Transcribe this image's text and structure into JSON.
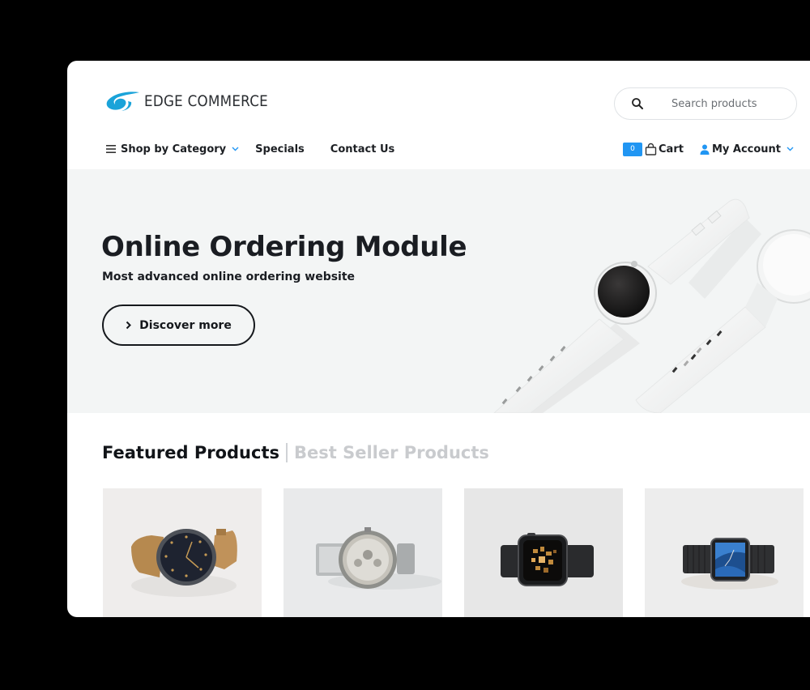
{
  "header": {
    "brand": "EDGE COMMERCE",
    "brand_color": "#1aa3d9",
    "search": {
      "placeholder": "Search products",
      "value": "",
      "icon": "search-icon"
    }
  },
  "nav": {
    "items": [
      {
        "label": "Shop by Category",
        "icon": "menu-icon",
        "has_dropdown": true
      },
      {
        "label": "Specials"
      },
      {
        "label": "Contact Us"
      }
    ],
    "cart": {
      "count": "0",
      "label": "Cart",
      "icon": "shopping-bag-icon",
      "badge_color": "#2196f3"
    },
    "account": {
      "label": "My Account",
      "icon": "user-icon",
      "has_dropdown": true,
      "icon_color": "#2196f3"
    }
  },
  "hero": {
    "title": "Online Ordering Module",
    "subtitle": "Most advanced online ordering website",
    "cta_label": "Discover more",
    "cta_icon": "chevron-right-icon",
    "image": "white-smartwatches"
  },
  "products_section": {
    "tabs": [
      {
        "label": "Featured Products",
        "active": true
      },
      {
        "label": "Best Seller Products",
        "active": false
      }
    ],
    "products": [
      {
        "image": "analog-watch-leather-strap"
      },
      {
        "image": "silver-chronograph-watch"
      },
      {
        "image": "smartwatch-black-band"
      },
      {
        "image": "smartwatch-link-bracelet"
      }
    ]
  }
}
